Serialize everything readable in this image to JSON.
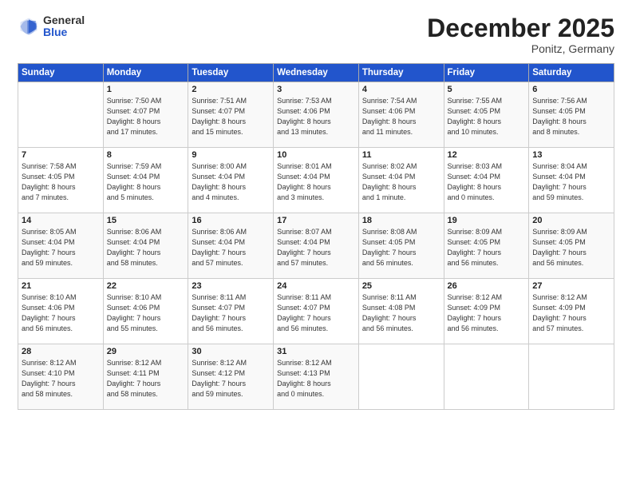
{
  "logo": {
    "general": "General",
    "blue": "Blue"
  },
  "header": {
    "month": "December 2025",
    "location": "Ponitz, Germany"
  },
  "days_of_week": [
    "Sunday",
    "Monday",
    "Tuesday",
    "Wednesday",
    "Thursday",
    "Friday",
    "Saturday"
  ],
  "weeks": [
    [
      {
        "day": "",
        "info": ""
      },
      {
        "day": "1",
        "info": "Sunrise: 7:50 AM\nSunset: 4:07 PM\nDaylight: 8 hours\nand 17 minutes."
      },
      {
        "day": "2",
        "info": "Sunrise: 7:51 AM\nSunset: 4:07 PM\nDaylight: 8 hours\nand 15 minutes."
      },
      {
        "day": "3",
        "info": "Sunrise: 7:53 AM\nSunset: 4:06 PM\nDaylight: 8 hours\nand 13 minutes."
      },
      {
        "day": "4",
        "info": "Sunrise: 7:54 AM\nSunset: 4:06 PM\nDaylight: 8 hours\nand 11 minutes."
      },
      {
        "day": "5",
        "info": "Sunrise: 7:55 AM\nSunset: 4:05 PM\nDaylight: 8 hours\nand 10 minutes."
      },
      {
        "day": "6",
        "info": "Sunrise: 7:56 AM\nSunset: 4:05 PM\nDaylight: 8 hours\nand 8 minutes."
      }
    ],
    [
      {
        "day": "7",
        "info": "Sunrise: 7:58 AM\nSunset: 4:05 PM\nDaylight: 8 hours\nand 7 minutes."
      },
      {
        "day": "8",
        "info": "Sunrise: 7:59 AM\nSunset: 4:04 PM\nDaylight: 8 hours\nand 5 minutes."
      },
      {
        "day": "9",
        "info": "Sunrise: 8:00 AM\nSunset: 4:04 PM\nDaylight: 8 hours\nand 4 minutes."
      },
      {
        "day": "10",
        "info": "Sunrise: 8:01 AM\nSunset: 4:04 PM\nDaylight: 8 hours\nand 3 minutes."
      },
      {
        "day": "11",
        "info": "Sunrise: 8:02 AM\nSunset: 4:04 PM\nDaylight: 8 hours\nand 1 minute."
      },
      {
        "day": "12",
        "info": "Sunrise: 8:03 AM\nSunset: 4:04 PM\nDaylight: 8 hours\nand 0 minutes."
      },
      {
        "day": "13",
        "info": "Sunrise: 8:04 AM\nSunset: 4:04 PM\nDaylight: 7 hours\nand 59 minutes."
      }
    ],
    [
      {
        "day": "14",
        "info": "Sunrise: 8:05 AM\nSunset: 4:04 PM\nDaylight: 7 hours\nand 59 minutes."
      },
      {
        "day": "15",
        "info": "Sunrise: 8:06 AM\nSunset: 4:04 PM\nDaylight: 7 hours\nand 58 minutes."
      },
      {
        "day": "16",
        "info": "Sunrise: 8:06 AM\nSunset: 4:04 PM\nDaylight: 7 hours\nand 57 minutes."
      },
      {
        "day": "17",
        "info": "Sunrise: 8:07 AM\nSunset: 4:04 PM\nDaylight: 7 hours\nand 57 minutes."
      },
      {
        "day": "18",
        "info": "Sunrise: 8:08 AM\nSunset: 4:05 PM\nDaylight: 7 hours\nand 56 minutes."
      },
      {
        "day": "19",
        "info": "Sunrise: 8:09 AM\nSunset: 4:05 PM\nDaylight: 7 hours\nand 56 minutes."
      },
      {
        "day": "20",
        "info": "Sunrise: 8:09 AM\nSunset: 4:05 PM\nDaylight: 7 hours\nand 56 minutes."
      }
    ],
    [
      {
        "day": "21",
        "info": "Sunrise: 8:10 AM\nSunset: 4:06 PM\nDaylight: 7 hours\nand 56 minutes."
      },
      {
        "day": "22",
        "info": "Sunrise: 8:10 AM\nSunset: 4:06 PM\nDaylight: 7 hours\nand 55 minutes."
      },
      {
        "day": "23",
        "info": "Sunrise: 8:11 AM\nSunset: 4:07 PM\nDaylight: 7 hours\nand 56 minutes."
      },
      {
        "day": "24",
        "info": "Sunrise: 8:11 AM\nSunset: 4:07 PM\nDaylight: 7 hours\nand 56 minutes."
      },
      {
        "day": "25",
        "info": "Sunrise: 8:11 AM\nSunset: 4:08 PM\nDaylight: 7 hours\nand 56 minutes."
      },
      {
        "day": "26",
        "info": "Sunrise: 8:12 AM\nSunset: 4:09 PM\nDaylight: 7 hours\nand 56 minutes."
      },
      {
        "day": "27",
        "info": "Sunrise: 8:12 AM\nSunset: 4:09 PM\nDaylight: 7 hours\nand 57 minutes."
      }
    ],
    [
      {
        "day": "28",
        "info": "Sunrise: 8:12 AM\nSunset: 4:10 PM\nDaylight: 7 hours\nand 58 minutes."
      },
      {
        "day": "29",
        "info": "Sunrise: 8:12 AM\nSunset: 4:11 PM\nDaylight: 7 hours\nand 58 minutes."
      },
      {
        "day": "30",
        "info": "Sunrise: 8:12 AM\nSunset: 4:12 PM\nDaylight: 7 hours\nand 59 minutes."
      },
      {
        "day": "31",
        "info": "Sunrise: 8:12 AM\nSunset: 4:13 PM\nDaylight: 8 hours\nand 0 minutes."
      },
      {
        "day": "",
        "info": ""
      },
      {
        "day": "",
        "info": ""
      },
      {
        "day": "",
        "info": ""
      }
    ]
  ]
}
